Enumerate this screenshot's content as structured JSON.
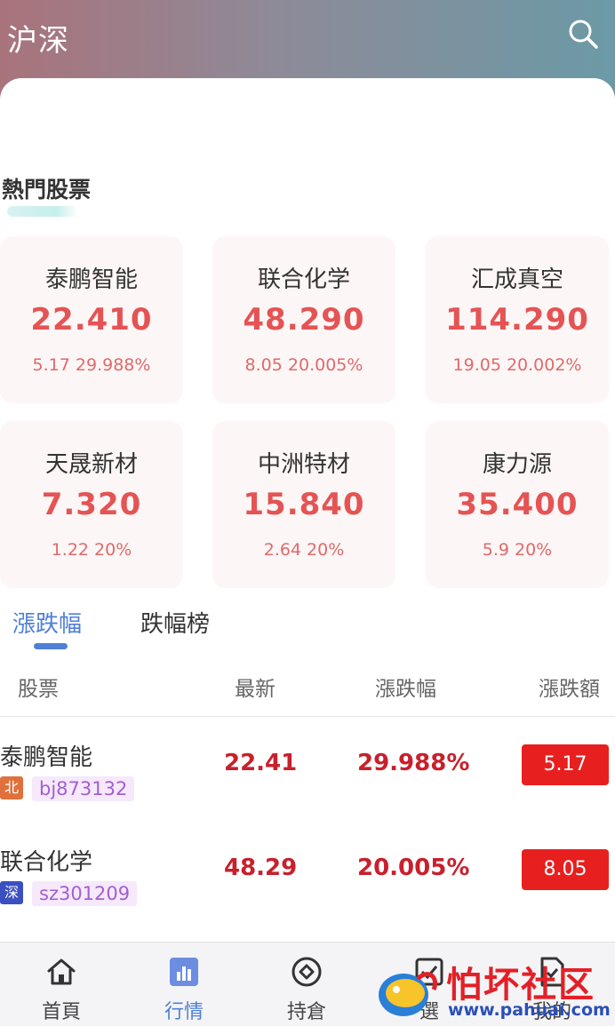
{
  "header": {
    "title": "沪深",
    "search_icon": "search-icon"
  },
  "hot": {
    "title": "熱門股票",
    "cards": [
      {
        "name": "泰鹏智能",
        "price": "22.410",
        "change": "5.17 29.988%"
      },
      {
        "name": "联合化学",
        "price": "48.290",
        "change": "8.05 20.005%"
      },
      {
        "name": "汇成真空",
        "price": "114.290",
        "change": "19.05 20.002%"
      },
      {
        "name": "天晟新材",
        "price": "7.320",
        "change": "1.22 20%"
      },
      {
        "name": "中洲特材",
        "price": "15.840",
        "change": "2.64 20%"
      },
      {
        "name": "康力源",
        "price": "35.400",
        "change": "5.9 20%"
      }
    ]
  },
  "tabs": [
    {
      "label": "漲跌幅",
      "active": true
    },
    {
      "label": "跌幅榜",
      "active": false
    }
  ],
  "table": {
    "headers": [
      "股票",
      "最新",
      "漲跌幅",
      "漲跌額"
    ],
    "rows": [
      {
        "name": "泰鹏智能",
        "badge": "北",
        "badge_color": "#e0703c",
        "code": "bj873132",
        "price": "22.41",
        "pct": "29.988%",
        "amount": "5.17"
      },
      {
        "name": "联合化学",
        "badge": "深",
        "badge_color": "#3a4fc0",
        "code": "sz301209",
        "price": "48.29",
        "pct": "20.005%",
        "amount": "8.05"
      }
    ]
  },
  "nav": [
    {
      "label": "首頁",
      "icon": "home-icon",
      "active": false
    },
    {
      "label": "行情",
      "icon": "chart-icon",
      "active": true
    },
    {
      "label": "持倉",
      "icon": "position-icon",
      "active": false
    },
    {
      "label": "選",
      "icon": "check-icon",
      "active": false
    },
    {
      "label": "我的",
      "icon": "profile-icon",
      "active": false
    }
  ],
  "watermark": {
    "text": "怕坏社区",
    "url": "www.pahuai.com"
  },
  "colors": {
    "accent": "#4f7fd8",
    "up_red": "#e45454",
    "badge_red": "#e81f1f"
  }
}
